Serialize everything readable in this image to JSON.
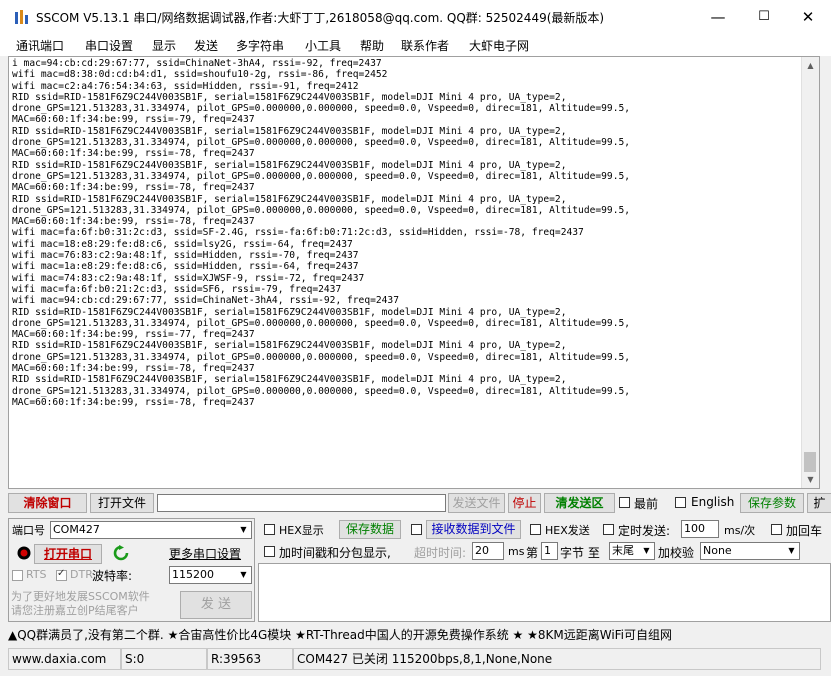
{
  "window": {
    "title": "SSCOM V5.13.1 串口/网络数据调试器,作者:大虾丁丁,2618058@qq.com. QQ群: 52502449(最新版本)",
    "minimize": "—",
    "maximize": "☐",
    "close": "✕"
  },
  "menu": [
    "通讯端口",
    "串口设置",
    "显示",
    "发送",
    "多字符串",
    "小工具",
    "帮助",
    "联系作者",
    "大虾电子网"
  ],
  "output": {
    "lines": [
      "i mac=94:cb:cd:29:67:77, ssid=ChinaNet-3hA4, rssi=-92, freq=2437",
      "wifi mac=d8:38:0d:cd:b4:d1, ssid=shoufu10-2g, rssi=-86, freq=2452",
      "wifi mac=c2:a4:76:54:34:63, ssid=Hidden, rssi=-91, freq=2412",
      "RID ssid=RID-1581F6Z9C244V003SB1F, serial=1581F6Z9C244V003SB1F, model=DJI Mini 4 pro, UA_type=2,",
      "drone_GPS=121.513283,31.334974, pilot_GPS=0.000000,0.000000, speed=0.0, Vspeed=0, direc=181, Altitude=99.5,",
      "MAC=60:60:1f:34:be:99, rssi=-79, freq=2437",
      "RID ssid=RID-1581F6Z9C244V003SB1F, serial=1581F6Z9C244V003SB1F, model=DJI Mini 4 pro, UA_type=2,",
      "drone_GPS=121.513283,31.334974, pilot_GPS=0.000000,0.000000, speed=0.0, Vspeed=0, direc=181, Altitude=99.5,",
      "MAC=60:60:1f:34:be:99, rssi=-78, freq=2437",
      "RID ssid=RID-1581F6Z9C244V003SB1F, serial=1581F6Z9C244V003SB1F, model=DJI Mini 4 pro, UA_type=2,",
      "drone_GPS=121.513283,31.334974, pilot_GPS=0.000000,0.000000, speed=0.0, Vspeed=0, direc=181, Altitude=99.5,",
      "MAC=60:60:1f:34:be:99, rssi=-78, freq=2437",
      "RID ssid=RID-1581F6Z9C244V003SB1F, serial=1581F6Z9C244V003SB1F, model=DJI Mini 4 pro, UA_type=2,",
      "drone_GPS=121.513283,31.334974, pilot_GPS=0.000000,0.000000, speed=0.0, Vspeed=0, direc=181, Altitude=99.5,",
      "MAC=60:60:1f:34:be:99, rssi=-78, freq=2437",
      "wifi mac=fa:6f:b0:31:2c:d3, ssid=SF-2.4G, rssi=-fa:6f:b0:71:2c:d3, ssid=Hidden, rssi=-78, freq=2437",
      "wifi mac=18:e8:29:fe:d8:c6, ssid=lsy2G, rssi=-64, freq=2437",
      "wifi mac=76:83:c2:9a:48:1f, ssid=Hidden, rssi=-70, freq=2437",
      "wifi mac=1a:e8:29:fe:d8:c6, ssid=Hidden, rssi=-64, freq=2437",
      "wifi mac=74:83:c2:9a:48:1f, ssid=XJWSF-9, rssi=-72, freq=2437",
      "wifi mac=fa:6f:b0:21:2c:d3, ssid=SF6, rssi=-79, freq=2437",
      "wifi mac=94:cb:cd:29:67:77, ssid=ChinaNet-3hA4, rssi=-92, freq=2437",
      "RID ssid=RID-1581F6Z9C244V003SB1F, serial=1581F6Z9C244V003SB1F, model=DJI Mini 4 pro, UA_type=2,",
      "drone_GPS=121.513283,31.334974, pilot_GPS=0.000000,0.000000, speed=0.0, Vspeed=0, direc=181, Altitude=99.5,",
      "MAC=60:60:1f:34:be:99, rssi=-77, freq=2437",
      "RID ssid=RID-1581F6Z9C244V003SB1F, serial=1581F6Z9C244V003SB1F, model=DJI Mini 4 pro, UA_type=2,",
      "drone_GPS=121.513283,31.334974, pilot_GPS=0.000000,0.000000, speed=0.0, Vspeed=0, direc=181, Altitude=99.5,",
      "MAC=60:60:1f:34:be:99, rssi=-78, freq=2437",
      "RID ssid=RID-1581F6Z9C244V003SB1F, serial=1581F6Z9C244V003SB1F, model=DJI Mini 4 pro, UA_type=2,",
      "drone_GPS=121.513283,31.334974, pilot_GPS=0.000000,0.000000, speed=0.0, Vspeed=0, direc=181, Altitude=99.5,",
      "MAC=60:60:1f:34:be:99, rssi=-78, freq=2437"
    ]
  },
  "toolbar": {
    "clear_window": "清除窗口",
    "open_file": "打开文件",
    "send_file": "发送文件",
    "stop": "停止",
    "clear_send": "清发送区",
    "top_label": "最前",
    "english_label": "English",
    "save_params": "保存参数",
    "expand": "扩"
  },
  "port": {
    "port_label": "端口号",
    "port_value": "COM427",
    "open_port": "打开串口",
    "more_settings": "更多串口设置",
    "rts_label": "RTS",
    "dtr_label": "DTR",
    "baud_label": "波特率:",
    "baud_value": "115200",
    "promo": "为了更好地发展SSCOM软件\n请您注册嘉立创P结尾客户",
    "send_button": "发 送"
  },
  "options": {
    "hex_display": "HEX显示",
    "save_data": "保存数据",
    "recv_to_file": "接收数据到文件",
    "hex_send": "HEX发送",
    "timed_send": "定时发送:",
    "timed_value": "100",
    "timed_unit": "ms/次",
    "add_crlf": "加回车",
    "timestamp": "加时间戳和分包显示,",
    "timeout_label": "超时时间:",
    "timeout_value": "20",
    "ms": "ms",
    "byte_label": "第",
    "byte_value": "1",
    "byte_to": "字节 至",
    "end_value": "末尾",
    "checksum_label": "加校验",
    "checksum_value": "None"
  },
  "marquee": "▲QQ群满员了,没有第二个群. ★合宙高性价比4G模块 ★RT-Thread中国人的开源免费操作系统 ★ ★8KM远距离WiFi可自组网",
  "status": {
    "site": "www.daxia.com",
    "s": "S:0",
    "r": "R:39563",
    "port_status": "COM427 已关闭  115200bps,8,1,None,None"
  }
}
